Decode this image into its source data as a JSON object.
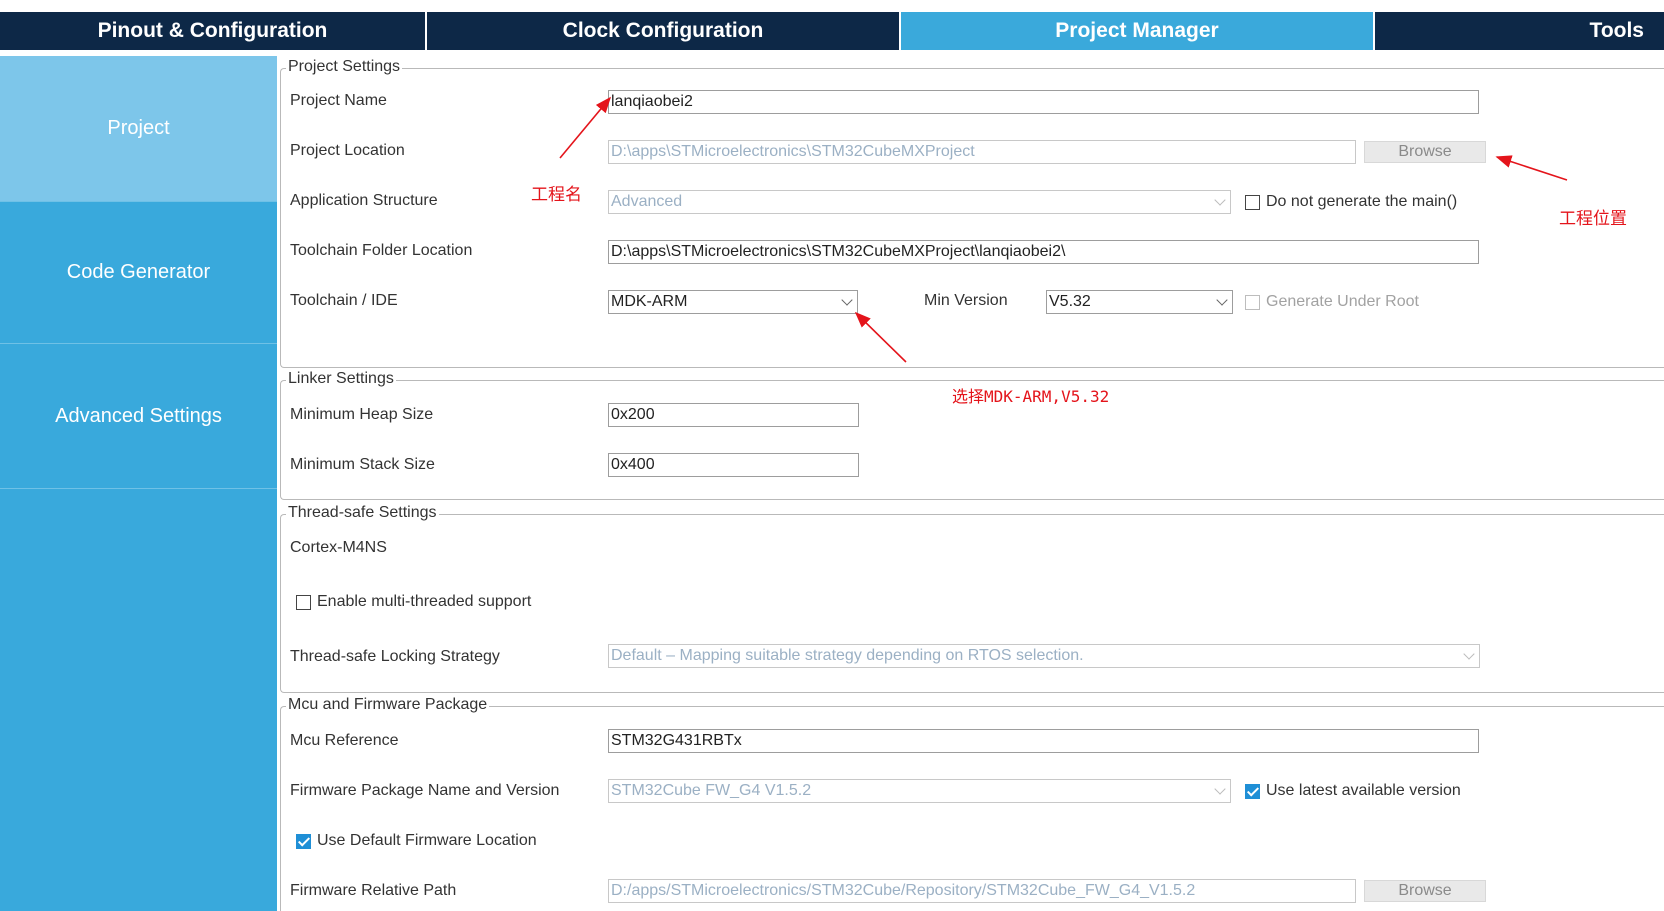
{
  "tabs": [
    {
      "label": "Pinout & Configuration"
    },
    {
      "label": "Clock Configuration"
    },
    {
      "label": "Project Manager"
    },
    {
      "label": "Tools"
    }
  ],
  "sidebar": {
    "items": [
      {
        "label": "Project"
      },
      {
        "label": "Code Generator"
      },
      {
        "label": "Advanced Settings"
      }
    ]
  },
  "project_settings": {
    "title": "Project Settings",
    "project_name_label": "Project Name",
    "project_name_value": "lanqiaobei2",
    "project_location_label": "Project Location",
    "project_location_value": "D:\\apps\\STMicroelectronics\\STM32CubeMXProject",
    "browse_label": "Browse",
    "app_structure_label": "Application Structure",
    "app_structure_value": "Advanced",
    "no_main_label": "Do not generate the main()",
    "toolchain_folder_label": "Toolchain Folder Location",
    "toolchain_folder_value": "D:\\apps\\STMicroelectronics\\STM32CubeMXProject\\lanqiaobei2\\",
    "toolchain_ide_label": "Toolchain / IDE",
    "toolchain_ide_value": "MDK-ARM",
    "min_version_label": "Min Version",
    "min_version_value": "V5.32",
    "gen_under_root_label": "Generate Under Root"
  },
  "linker_settings": {
    "title": "Linker Settings",
    "heap_label": "Minimum Heap Size",
    "heap_value": "0x200",
    "stack_label": "Minimum Stack Size",
    "stack_value": "0x400"
  },
  "thread_safe": {
    "title": "Thread-safe Settings",
    "core_label": "Cortex-M4NS",
    "multi_thread_label": "Enable multi-threaded support",
    "locking_label": "Thread-safe Locking Strategy",
    "locking_value": "Default  –  Mapping suitable strategy depending on RTOS selection."
  },
  "mcu_firmware": {
    "title": "Mcu and Firmware Package",
    "mcu_ref_label": "Mcu Reference",
    "mcu_ref_value": "STM32G431RBTx",
    "fw_pkg_label": "Firmware Package Name and Version",
    "fw_pkg_value": "STM32Cube FW_G4 V1.5.2",
    "latest_label": "Use latest available version",
    "default_loc_label": "Use Default Firmware Location",
    "fw_path_label": "Firmware Relative Path",
    "fw_path_value": "D:/apps/STMicroelectronics/STM32Cube/Repository/STM32Cube_FW_G4_V1.5.2",
    "browse_label": "Browse"
  },
  "annotations": {
    "project_name_note": "工程名",
    "project_location_note": "工程位置",
    "toolchain_note": "选择MDK-ARM,V5.32"
  },
  "colors": {
    "tab_dark": "#0d2847",
    "tab_active": "#3aa9db",
    "sidebar": "#39a9dc",
    "sidebar_active": "#7dc6ea",
    "annotation": "#e4141b",
    "checkbox_checked": "#1f8fd6"
  }
}
